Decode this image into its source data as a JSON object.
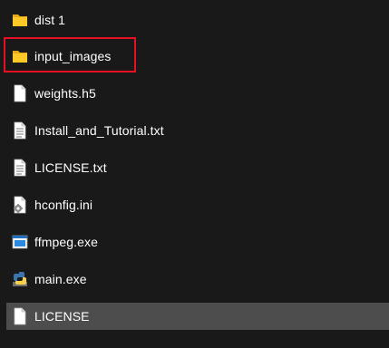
{
  "files": [
    {
      "name": "dist 1",
      "icon": "folder-icon"
    },
    {
      "name": "input_images",
      "icon": "folder-icon"
    },
    {
      "name": "weights.h5",
      "icon": "file-icon"
    },
    {
      "name": "Install_and_Tutorial.txt",
      "icon": "text-file-icon"
    },
    {
      "name": "LICENSE.txt",
      "icon": "text-file-icon"
    },
    {
      "name": "hconfig.ini",
      "icon": "settings-file-icon"
    },
    {
      "name": "ffmpeg.exe",
      "icon": "application-icon"
    },
    {
      "name": "main.exe",
      "icon": "python-executable-icon"
    },
    {
      "name": "LICENSE",
      "icon": "file-icon"
    }
  ],
  "selected_item": "LICENSE",
  "highlighted_item": "input_images",
  "colors": {
    "background": "#191919",
    "selection": "#4d4d4d",
    "highlight_border": "#e81123",
    "folder": "#ffca28",
    "text": "#ffffff"
  }
}
